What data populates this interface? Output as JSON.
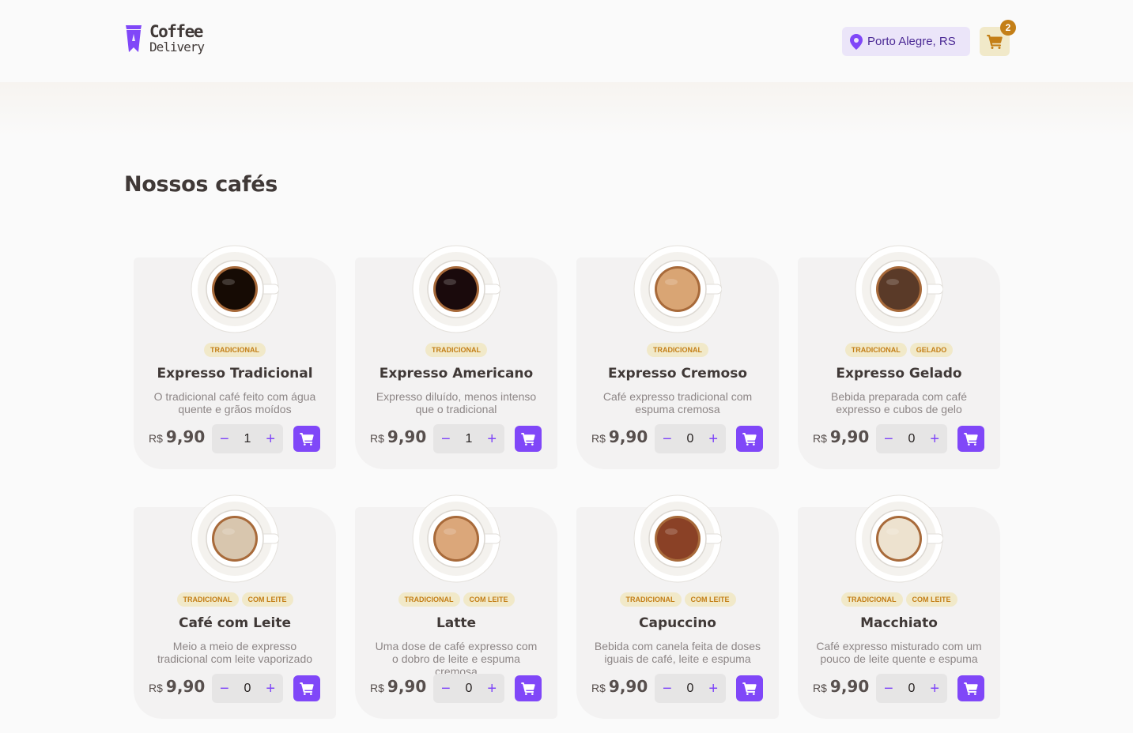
{
  "header": {
    "logo_line1": "Coffee",
    "logo_line2": "Delivery",
    "location": "Porto Alegre, RS",
    "cart_count": "2"
  },
  "main": {
    "section_title": "Nossos cafés"
  },
  "currency": "R$",
  "colors": {
    "purple": "#8047f8",
    "purple_dark": "#4b2995",
    "purple_light": "#ebe5f9",
    "yellow_dark": "#c47f17",
    "yellow_light": "#f1e9c9",
    "card_bg": "#f3f2f2"
  },
  "coffees": [
    {
      "name": "Expresso Tradicional",
      "description": "O tradicional café feito com água quente e grãos moídos",
      "tags": [
        "TRADICIONAL"
      ],
      "price": "9,90",
      "quantity": "1",
      "coffee_color": "#160b04"
    },
    {
      "name": "Expresso Americano",
      "description": "Expresso diluído, menos intenso que o tradicional",
      "tags": [
        "TRADICIONAL"
      ],
      "price": "9,90",
      "quantity": "1",
      "coffee_color": "#1a0a0c"
    },
    {
      "name": "Expresso Cremoso",
      "description": "Café expresso tradicional com espuma cremosa",
      "tags": [
        "TRADICIONAL"
      ],
      "price": "9,90",
      "quantity": "0",
      "coffee_color": "#d9a574"
    },
    {
      "name": "Expresso Gelado",
      "description": "Bebida preparada com café expresso e cubos de gelo",
      "tags": [
        "TRADICIONAL",
        "GELADO"
      ],
      "price": "9,90",
      "quantity": "0",
      "coffee_color": "#5a3a28"
    },
    {
      "name": "Café com Leite",
      "description": "Meio a meio de expresso tradicional com leite vaporizado",
      "tags": [
        "TRADICIONAL",
        "COM LEITE"
      ],
      "price": "9,90",
      "quantity": "0",
      "coffee_color": "#d8c6ae"
    },
    {
      "name": "Latte",
      "description": "Uma dose de café expresso com o dobro de leite e espuma cremosa",
      "tags": [
        "TRADICIONAL",
        "COM LEITE"
      ],
      "price": "9,90",
      "quantity": "0",
      "coffee_color": "#dba77a"
    },
    {
      "name": "Capuccino",
      "description": "Bebida com canela feita de doses iguais de café, leite e espuma",
      "tags": [
        "TRADICIONAL",
        "COM LEITE"
      ],
      "price": "9,90",
      "quantity": "0",
      "coffee_color": "#8a4126"
    },
    {
      "name": "Macchiato",
      "description": "Café expresso misturado com um pouco de leite quente e espuma",
      "tags": [
        "TRADICIONAL",
        "COM LEITE"
      ],
      "price": "9,90",
      "quantity": "0",
      "coffee_color": "#ede2cf"
    }
  ]
}
